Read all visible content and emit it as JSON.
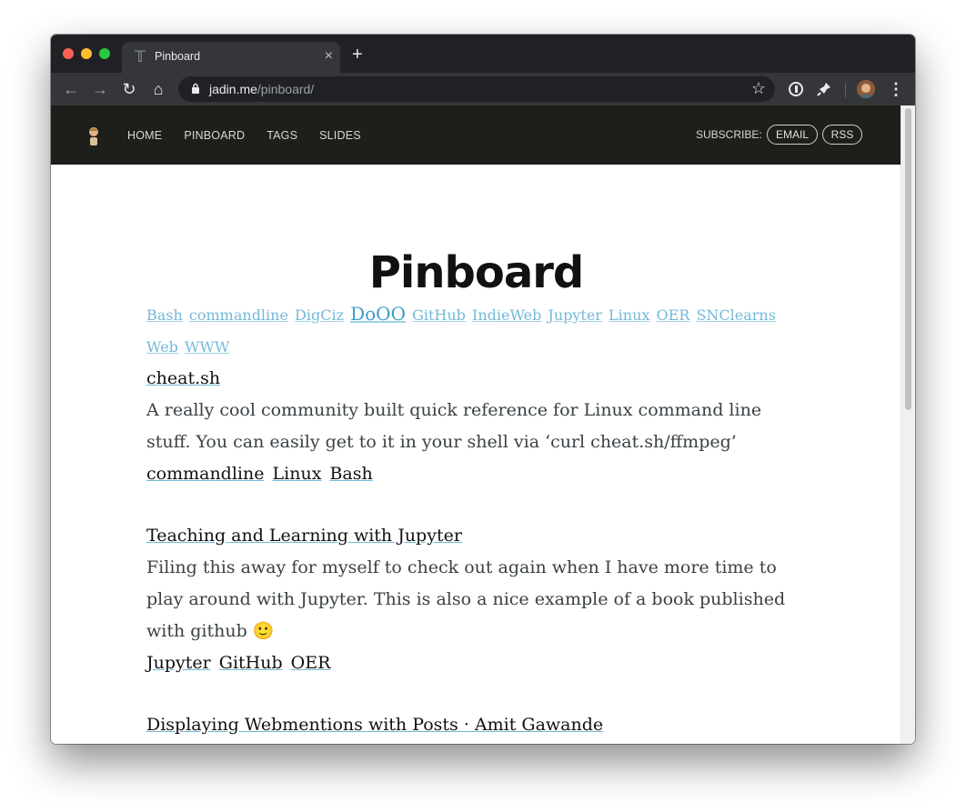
{
  "browser": {
    "tab_title": "Pinboard",
    "tab_close": "×",
    "new_tab": "+",
    "url_host": "jadin.me",
    "url_path": "/pinboard/",
    "back": "←",
    "forward": "→",
    "reload": "↻",
    "home": "⌂",
    "star": "☆",
    "menu": "⋮"
  },
  "site": {
    "nav": [
      {
        "label": "HOME"
      },
      {
        "label": "PINBOARD"
      },
      {
        "label": "TAGS"
      },
      {
        "label": "SLIDES"
      }
    ],
    "subscribe_label": "SUBSCRIBE:",
    "email_label": "EMAIL",
    "rss_label": "RSS"
  },
  "page": {
    "title": "Pinboard",
    "tags": [
      "Bash",
      "commandline",
      "DigCiz",
      "DoOO",
      "GitHub",
      "IndieWeb",
      "Jupyter",
      "Linux",
      "OER",
      "SNClearns",
      "Web",
      "WWW"
    ],
    "pins": [
      {
        "title": "cheat.sh",
        "description": "A really cool community built quick reference for Linux command line stuff. You can easily get to it in your shell via ‘curl cheat.sh/ffmpeg’",
        "tags": [
          "commandline",
          "Linux",
          "Bash"
        ]
      },
      {
        "title": "Teaching and Learning with Jupyter",
        "description": "Filing this away for myself to check out again when I have more time to play around with Jupyter. This is also a nice example of a book published with github 🙂",
        "tags": [
          "Jupyter",
          "GitHub",
          "OER"
        ]
      },
      {
        "title": "Displaying Webmentions with Posts · Amit Gawande",
        "description": "",
        "tags": []
      }
    ]
  },
  "colors": {
    "header_bg": "#1e1e1b",
    "tag_link": "#74b9d8",
    "chrome_dark": "#202124"
  }
}
